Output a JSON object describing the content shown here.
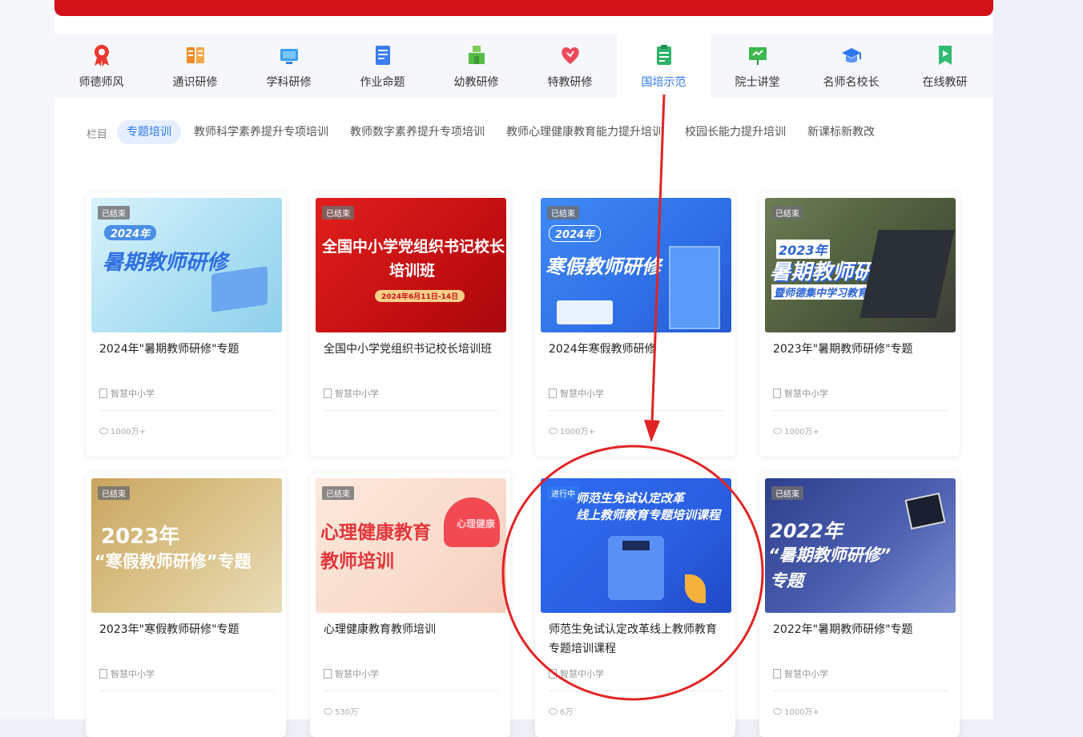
{
  "nav": {
    "items": [
      {
        "label": "师德师风",
        "icon": "award-ribbon-icon",
        "color": "#e8382f"
      },
      {
        "label": "通识研修",
        "icon": "book-columns-icon",
        "color": "#f08d2a"
      },
      {
        "label": "学科研修",
        "icon": "monitor-icon",
        "color": "#3aa0f2"
      },
      {
        "label": "作业命题",
        "icon": "notepad-icon",
        "color": "#3b7df3"
      },
      {
        "label": "幼教研修",
        "icon": "toy-blocks-icon",
        "color": "#55bd45"
      },
      {
        "label": "特教研修",
        "icon": "heart-icon",
        "color": "#ef4a5c"
      },
      {
        "label": "国培示范",
        "icon": "clipboard-icon",
        "color": "#2db36a"
      },
      {
        "label": "院士讲堂",
        "icon": "lecture-board-icon",
        "color": "#3cb850"
      },
      {
        "label": "名师名校长",
        "icon": "graduation-cap-icon",
        "color": "#2e78ef"
      },
      {
        "label": "在线教研",
        "icon": "bookmark-play-icon",
        "color": "#31bb74"
      }
    ],
    "active_index": 6
  },
  "subtabs": {
    "prefix": "栏目",
    "items": [
      "专题培训",
      "教师科学素养提升专项培训",
      "教师数字素养提升专项培训",
      "教师心理健康教育能力提升培训",
      "校园长能力提升培训",
      "新课标新教改"
    ],
    "active_index": 0
  },
  "cards": [
    {
      "badge": "已结束",
      "thumb_lines": [
        "2024年",
        "暑期教师研修"
      ],
      "title": "2024年\"暑期教师研修\"专题",
      "source": "智慧中小学",
      "views": "1000万+"
    },
    {
      "badge": "已结束",
      "thumb_lines": [
        "全国中小学党组织书记校长",
        "培训班",
        "2024年6月11日-14日"
      ],
      "title": "全国中小学党组织书记校长培训班",
      "source": "智慧中小学",
      "views": ""
    },
    {
      "badge": "已结束",
      "thumb_lines": [
        "2024年",
        "寒假教师研修"
      ],
      "title": "2024年寒假教师研修",
      "source": "智慧中小学",
      "views": "1000万+"
    },
    {
      "badge": "已结束",
      "thumb_lines": [
        "2023年",
        "暑期教师研修",
        "暨师德集中学习教育"
      ],
      "title": "2023年\"暑期教师研修\"专题",
      "source": "智慧中小学",
      "views": "1000万+"
    },
    {
      "badge": "已结束",
      "thumb_lines": [
        "2023年",
        "“寒假教师研修”专题"
      ],
      "title": "2023年\"寒假教师研修\"专题",
      "source": "智慧中小学",
      "views": ""
    },
    {
      "badge": "已结束",
      "thumb_lines": [
        "心理健康教育",
        "教师培训",
        "心理健康"
      ],
      "title": "心理健康教育教师培训",
      "source": "智慧中小学",
      "views": "530万"
    },
    {
      "badge": "进行中",
      "thumb_lines": "师范生免试认定改革|线上教师教育专题培训课程",
      "title": "师范生免试认定改革线上教师教育专题培训课程",
      "source": "智慧中小学",
      "views": "6万"
    },
    {
      "badge": "已结束",
      "thumb_lines": [
        "2022年",
        "“暑期教师研修”",
        "专题"
      ],
      "title": "2022年\"暑期教师研修\"专题",
      "source": "智慧中小学",
      "views": "1000万+"
    }
  ],
  "colors": {
    "brand_red": "#d4121a",
    "active_blue": "#2f77f1",
    "annotation_red": "#e02424"
  }
}
